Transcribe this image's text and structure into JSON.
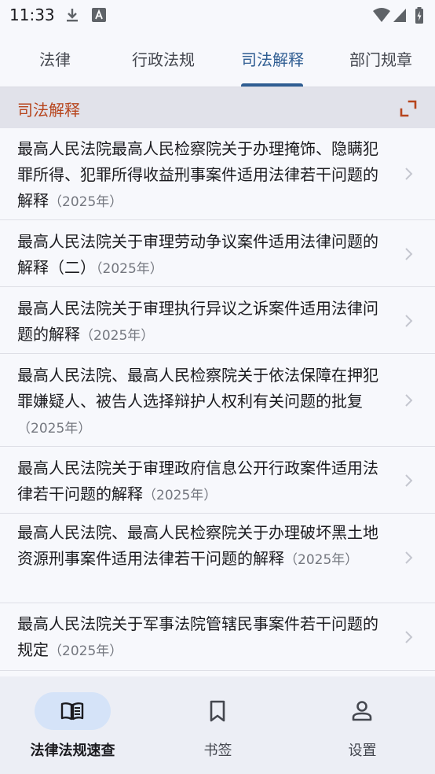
{
  "status_bar": {
    "time": "11:33"
  },
  "tabs": [
    {
      "label": "法律"
    },
    {
      "label": "行政法规"
    },
    {
      "label": "司法解释"
    },
    {
      "label": "部门规章"
    }
  ],
  "active_tab": "司法解释",
  "section": {
    "title": "司法解释"
  },
  "items": [
    {
      "title": "最高人民法院最高人民检察院关于办理掩饰、隐瞒犯罪所得、犯罪所得收益刑事案件适用法律若干问题的解释",
      "year": "（2025年）"
    },
    {
      "title": "最高人民法院关于审理劳动争议案件适用法律问题的解释（二）",
      "year": "（2025年）"
    },
    {
      "title": "最高人民法院关于审理执行异议之诉案件适用法律问题的解释",
      "year": "（2025年）"
    },
    {
      "title": "最高人民法院、最高人民检察院关于依法保障在押犯罪嫌疑人、被告人选择辩护人权利有关问题的批复",
      "year": "（2025年）"
    },
    {
      "title": "最高人民法院关于审理政府信息公开行政案件适用法律若干问题的解释",
      "year": "（2025年）"
    },
    {
      "title": "最高人民法院、最高人民检察院关于办理破坏黑土地资源刑事案件适用法律若干问题的解释",
      "year": "（2025年）"
    },
    {
      "title": "最高人民法院关于军事法院管辖民事案件若干问题的规定",
      "year": "（2025年）"
    }
  ],
  "bottom_nav": [
    {
      "label": "法律法规速查",
      "icon": "book-open-icon"
    },
    {
      "label": "书签",
      "icon": "bookmark-icon"
    },
    {
      "label": "设置",
      "icon": "person-icon"
    }
  ],
  "colors": {
    "accent": "#2f5d92",
    "section_title": "#b7451d",
    "nav_pill": "#d5e3f8"
  }
}
